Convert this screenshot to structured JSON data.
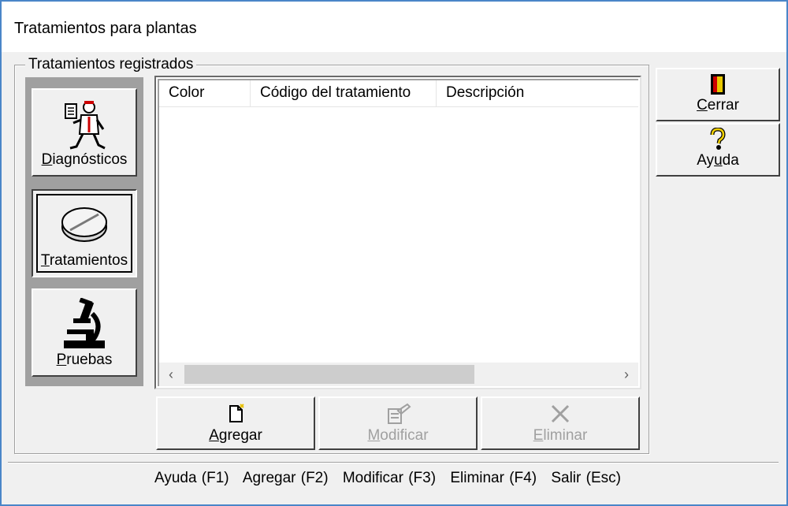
{
  "window": {
    "title": "Tratamientos para plantas"
  },
  "group": {
    "legend": "Tratamientos registrados"
  },
  "nav": {
    "items": [
      {
        "pre": "",
        "key": "D",
        "post": "iagnósticos",
        "icon": "doctor-icon"
      },
      {
        "pre": "",
        "key": "T",
        "post": "ratamientos",
        "icon": "pill-icon",
        "selected": true
      },
      {
        "pre": "",
        "key": "P",
        "post": "ruebas",
        "icon": "microscope-icon"
      }
    ]
  },
  "table": {
    "columns": [
      "Color",
      "Código del tratamiento",
      "Descripción"
    ],
    "rows": [],
    "scroll_left": "‹",
    "scroll_right": "›"
  },
  "actions": {
    "add": {
      "pre": "",
      "key": "A",
      "post": "gregar",
      "icon": "new-document-icon"
    },
    "modify": {
      "pre": "",
      "key": "M",
      "post": "odificar",
      "icon": "edit-document-icon",
      "disabled": true
    },
    "delete": {
      "pre": "",
      "key": "E",
      "post": "liminar",
      "icon": "delete-x-icon",
      "disabled": true
    }
  },
  "side": {
    "close": {
      "pre": "",
      "key": "C",
      "post": "errar",
      "icon": "door-exit-icon"
    },
    "help": {
      "pre": "Ay",
      "key": "u",
      "post": "da",
      "icon": "question-mark-icon"
    }
  },
  "statusbar": {
    "items": [
      "Ayuda (F1)",
      "Agregar (F2)",
      "Modificar (F3)",
      "Eliminar (F4)",
      "Salir (Esc)"
    ]
  },
  "colors": {
    "frame_border": "#4a86c8",
    "face": "#f0f0f0",
    "nav_bg": "#a0a0a0"
  }
}
